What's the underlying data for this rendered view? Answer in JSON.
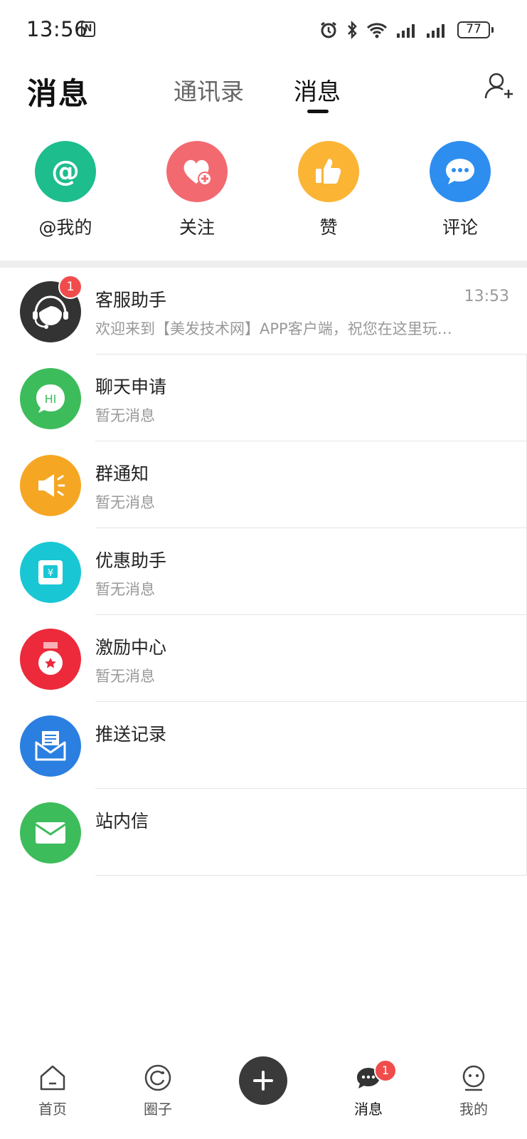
{
  "status_bar": {
    "time": "13:56",
    "nfc": "N",
    "battery": "77"
  },
  "header": {
    "title": "消息",
    "tabs": [
      {
        "label": "通讯录"
      },
      {
        "label": "消息"
      }
    ]
  },
  "quick_actions": [
    {
      "label": "@我的",
      "icon": "at-icon",
      "color": "#1dbd8e"
    },
    {
      "label": "关注",
      "icon": "heart-plus-icon",
      "color": "#f26a70"
    },
    {
      "label": "赞",
      "icon": "thumbs-up-icon",
      "color": "#fbb434"
    },
    {
      "label": "评论",
      "icon": "comment-icon",
      "color": "#2d8ef0"
    }
  ],
  "messages": [
    {
      "name": "客服助手",
      "preview": "欢迎来到【美发技术网】APP客户端，祝您在这里玩…",
      "time": "13:53",
      "badge": "1",
      "icon": "customer-service-icon",
      "color": "#333333"
    },
    {
      "name": "聊天申请",
      "preview": "暂无消息",
      "icon": "chat-hi-icon",
      "icon_text": "HI",
      "color": "#3dbc5b"
    },
    {
      "name": "群通知",
      "preview": "暂无消息",
      "icon": "megaphone-icon",
      "color": "#f5a623"
    },
    {
      "name": "优惠助手",
      "preview": "暂无消息",
      "icon": "coupon-icon",
      "icon_text": "¥",
      "color": "#19c7d4"
    },
    {
      "name": "激励中心",
      "preview": "暂无消息",
      "icon": "medal-icon",
      "color": "#ec2a3b"
    },
    {
      "name": "推送记录",
      "preview": "",
      "icon": "push-mail-icon",
      "color": "#2b7fe0"
    },
    {
      "name": "站内信",
      "preview": "",
      "icon": "envelope-icon",
      "color": "#3dbc5b"
    }
  ],
  "bottom_nav": {
    "items": [
      {
        "label": "首页",
        "icon": "home-icon"
      },
      {
        "label": "圈子",
        "icon": "circle-icon"
      },
      {
        "label": "",
        "icon": "plus-icon"
      },
      {
        "label": "消息",
        "icon": "message-icon",
        "badge": "1"
      },
      {
        "label": "我的",
        "icon": "profile-icon"
      }
    ]
  }
}
